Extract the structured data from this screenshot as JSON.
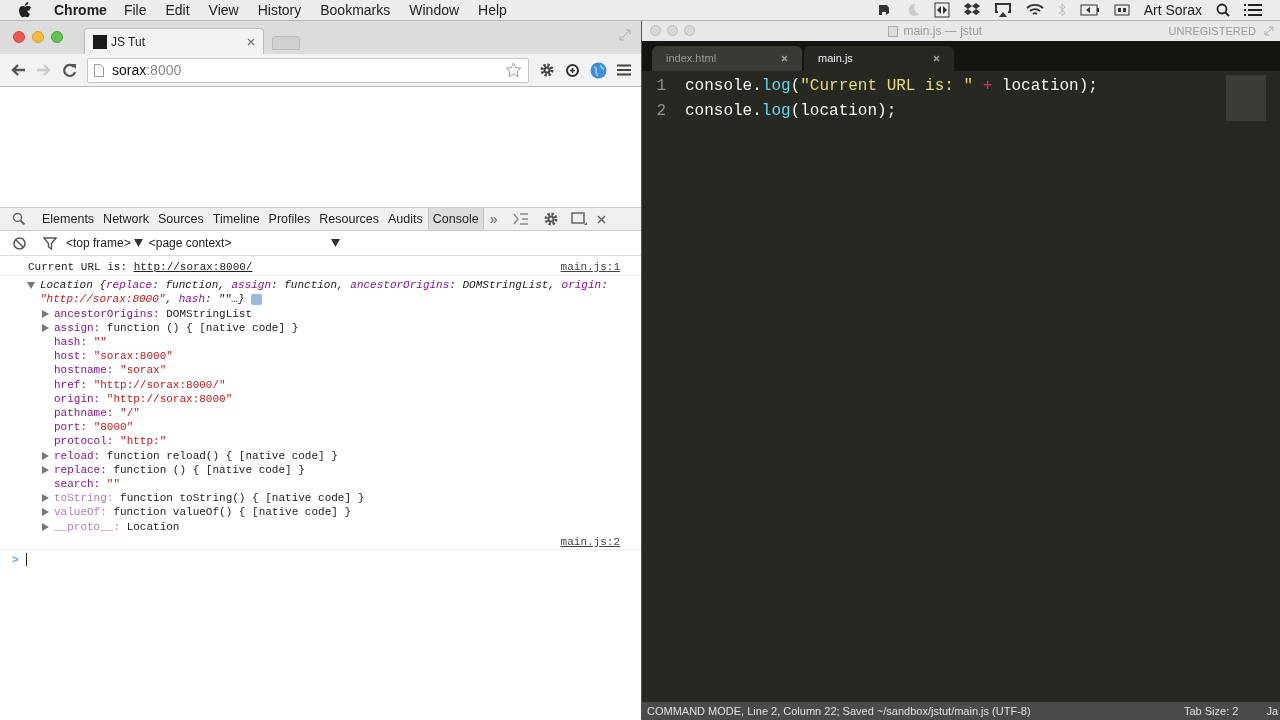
{
  "menu_bar": {
    "app": "Chrome",
    "items": [
      "File",
      "Edit",
      "View",
      "History",
      "Bookmarks",
      "Window",
      "Help"
    ],
    "user": "Art Sorax"
  },
  "browser": {
    "tabs": [
      {
        "title": "JS Tut",
        "selected": true
      }
    ],
    "address": {
      "host": "sorax",
      "port": ":8000"
    },
    "devtools": {
      "tabs": [
        {
          "label": "Elements",
          "selected": false
        },
        {
          "label": "Network",
          "selected": false
        },
        {
          "label": "Sources",
          "selected": false
        },
        {
          "label": "Timeline",
          "selected": false
        },
        {
          "label": "Profiles",
          "selected": false
        },
        {
          "label": "Resources",
          "selected": false
        },
        {
          "label": "Audits",
          "selected": false
        },
        {
          "label": "Console",
          "selected": true
        }
      ],
      "more": "»",
      "frame": "<top frame>",
      "context": "<page context>",
      "console": {
        "log": {
          "text": "Current URL is: ",
          "link": "http://sorax:8000/",
          "source": "main.js:1"
        },
        "object": {
          "expanded": true,
          "summary": [
            {
              "kind": "plain",
              "text": "Location {"
            },
            {
              "kind": "key",
              "text": "replace"
            },
            {
              "kind": "plain",
              "text": ": function, "
            },
            {
              "kind": "key",
              "text": "assign"
            },
            {
              "kind": "plain",
              "text": ": function, "
            },
            {
              "kind": "key",
              "text": "ancestorOrigins"
            },
            {
              "kind": "plain",
              "text": ": DOMStringList, "
            },
            {
              "kind": "key",
              "text": "origin"
            },
            {
              "kind": "plain",
              "text": ": "
            },
            {
              "kind": "string",
              "text": "\"http://sorax:8000\""
            },
            {
              "kind": "plain",
              "text": ", "
            },
            {
              "kind": "key",
              "text": "hash"
            },
            {
              "kind": "plain",
              "text": ": \"\"…}"
            }
          ],
          "properties": [
            {
              "key": "ancestorOrigins:",
              "value": "DOMStringList",
              "expandable": true,
              "kind": "own",
              "string_value": false
            },
            {
              "key": "assign:",
              "value": "function () { [native code] }",
              "expandable": true,
              "kind": "own",
              "string_value": false
            },
            {
              "key": "hash:",
              "value": "\"\"",
              "expandable": false,
              "kind": "own",
              "string_value": true
            },
            {
              "key": "host:",
              "value": "\"sorax:8000\"",
              "expandable": false,
              "kind": "own",
              "string_value": true
            },
            {
              "key": "hostname:",
              "value": "\"sorax\"",
              "expandable": false,
              "kind": "own",
              "string_value": true
            },
            {
              "key": "href:",
              "value": "\"http://sorax:8000/\"",
              "expandable": false,
              "kind": "own",
              "string_value": true
            },
            {
              "key": "origin:",
              "value": "\"http://sorax:8000\"",
              "expandable": false,
              "kind": "own",
              "string_value": true
            },
            {
              "key": "pathname:",
              "value": "\"/\"",
              "expandable": false,
              "kind": "own",
              "string_value": true
            },
            {
              "key": "port:",
              "value": "\"8000\"",
              "expandable": false,
              "kind": "own",
              "string_value": true
            },
            {
              "key": "protocol:",
              "value": "\"http:\"",
              "expandable": false,
              "kind": "own",
              "string_value": true
            },
            {
              "key": "reload:",
              "value": "function reload() { [native code] }",
              "expandable": true,
              "kind": "own",
              "string_value": false
            },
            {
              "key": "replace:",
              "value": "function () { [native code] }",
              "expandable": true,
              "kind": "own",
              "string_value": false
            },
            {
              "key": "search:",
              "value": "\"\"",
              "expandable": false,
              "kind": "own",
              "string_value": true
            },
            {
              "key": "toString:",
              "value": "function toString() { [native code] }",
              "expandable": true,
              "kind": "inherited",
              "string_value": false
            },
            {
              "key": "valueOf:",
              "value": "function valueOf() { [native code] }",
              "expandable": true,
              "kind": "inherited",
              "string_value": false
            },
            {
              "key": "__proto__:",
              "value": "Location",
              "expandable": true,
              "kind": "inherited",
              "string_value": false
            }
          ],
          "source": "main.js:2"
        },
        "prompt": ">"
      }
    }
  },
  "editor": {
    "title": "main.js — jstut",
    "license": "UNREGISTERED",
    "tabs": [
      {
        "label": "index.html",
        "selected": false
      },
      {
        "label": "main.js",
        "selected": true
      }
    ],
    "lines": [
      {
        "number": "1",
        "tokens": [
          {
            "kind": "plain",
            "text": "console."
          },
          {
            "kind": "func",
            "text": "log"
          },
          {
            "kind": "plain",
            "text": "("
          },
          {
            "kind": "string",
            "text": "\"Current URL is: \""
          },
          {
            "kind": "operator",
            "text": " +"
          },
          {
            "kind": "plain",
            "text": " location);"
          }
        ]
      },
      {
        "number": "2",
        "tokens": [
          {
            "kind": "plain",
            "text": "console."
          },
          {
            "kind": "func",
            "text": "log"
          },
          {
            "kind": "plain",
            "text": "(location);"
          }
        ]
      }
    ],
    "status": "COMMAND MODE, Line 2, Column 22; Saved ~/sandbox/jstut/main.js (UTF-8)",
    "tab_size": "Tab Size: 2",
    "syntax": "Ja"
  }
}
